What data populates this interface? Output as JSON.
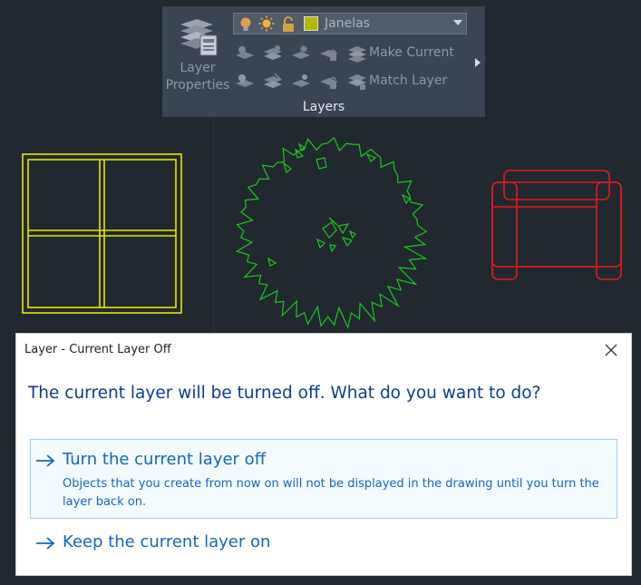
{
  "ribbon": {
    "layer_properties_label": "Layer\nProperties",
    "current_layer_name": "Janelas",
    "current_layer_color": "#b5b800",
    "make_current_label": "Make Current",
    "match_layer_label": "Match Layer",
    "panel_title": "Layers"
  },
  "drawing": {
    "window_color": "#e6e600",
    "tree_color": "#19c919",
    "sofa_color": "#e31b1b"
  },
  "dialog": {
    "title": "Layer - Current Layer Off",
    "question": "The current layer will be turned off. What do you want to do?",
    "options": [
      {
        "title": "Turn the current layer off",
        "description": "Objects that you create from now on will not be displayed in the drawing until you turn the layer back on."
      },
      {
        "title": "Keep the current layer on"
      }
    ]
  }
}
